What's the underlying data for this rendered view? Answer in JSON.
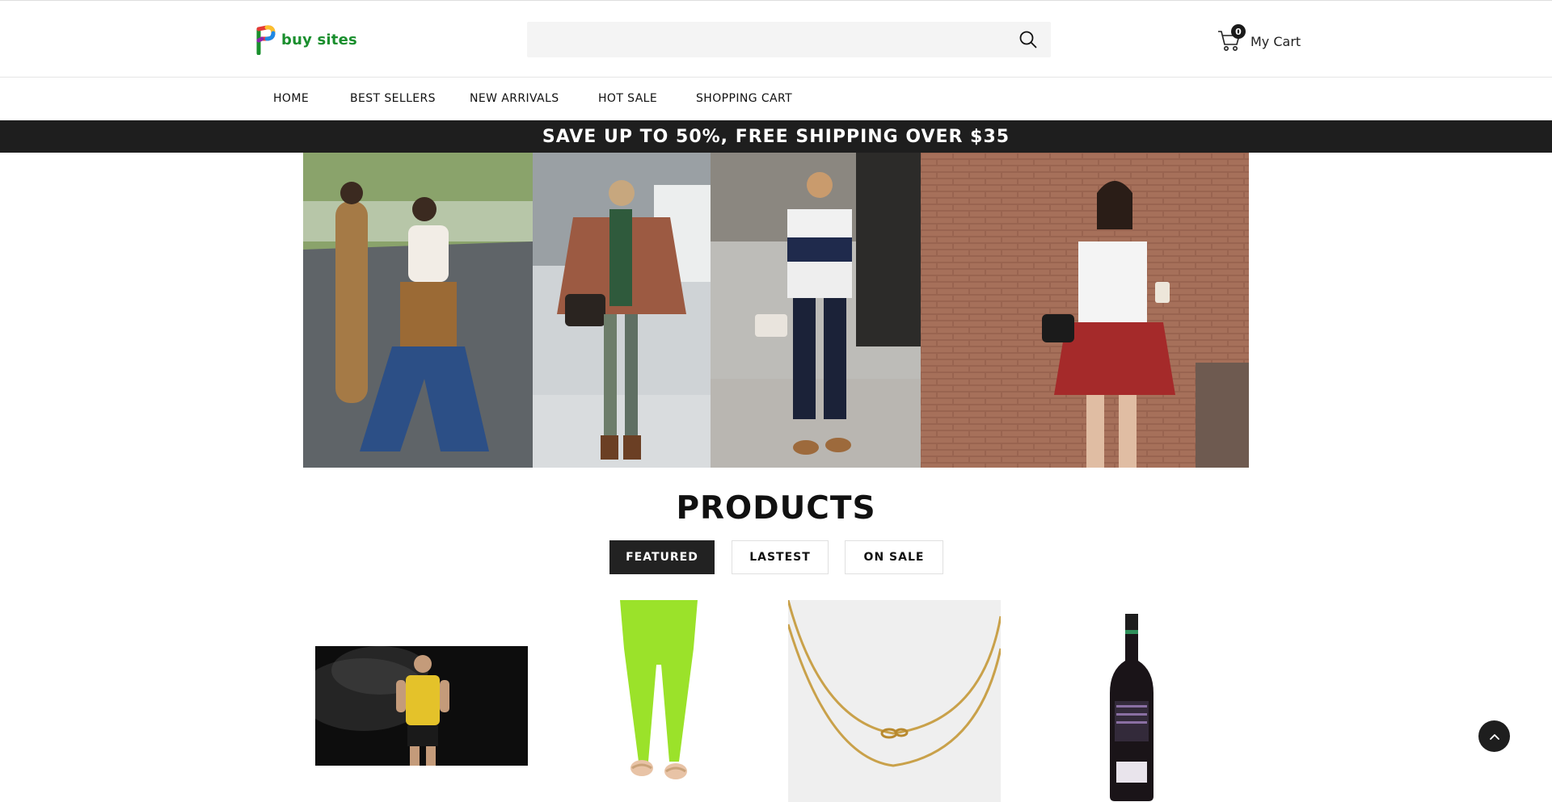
{
  "brand": {
    "name": "buy sites",
    "colors": {
      "green": "#1a8f2e",
      "red": "#e53935",
      "yellow": "#fbc02d",
      "blue": "#1e88e5"
    }
  },
  "search": {
    "placeholder": "",
    "value": "",
    "icon": "search-icon"
  },
  "cart": {
    "count": "0",
    "label": "My Cart",
    "icon": "cart-icon"
  },
  "nav": {
    "items": [
      {
        "label": "HOME"
      },
      {
        "label": "BEST SELLERS"
      },
      {
        "label": "NEW ARRIVALS"
      },
      {
        "label": "HOT SALE"
      },
      {
        "label": "SHOPPING CART"
      }
    ]
  },
  "promo": {
    "text": "SAVE UP TO 50%, FREE SHIPPING OVER $35",
    "background": "#1e1e1e"
  },
  "banner": {
    "panels": [
      {
        "subject": "two women walking on street"
      },
      {
        "subject": "woman in plaid poncho and scarf"
      },
      {
        "subject": "woman in striped tee and jeans"
      },
      {
        "subject": "woman in white tee with plaid shirt"
      }
    ]
  },
  "products": {
    "title": "PRODUCTS",
    "tabs": [
      {
        "label": "FEATURED",
        "active": true
      },
      {
        "label": "LASTEST",
        "active": false
      },
      {
        "label": "ON SALE",
        "active": false
      }
    ],
    "items": [
      {
        "subject": "athlete in yellow tank top"
      },
      {
        "subject": "lime green leggings"
      },
      {
        "subject": "gold chain necklace"
      },
      {
        "subject": "red wine bottle"
      }
    ]
  },
  "back_to_top": {
    "icon": "chevron-up-icon"
  }
}
